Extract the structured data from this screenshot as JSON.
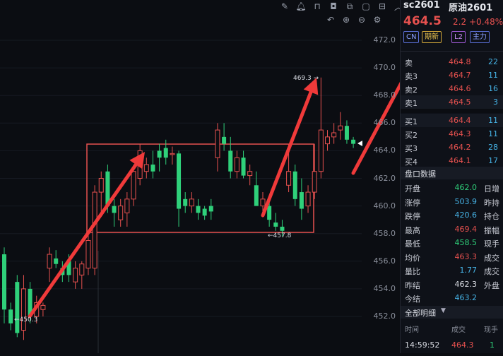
{
  "chart": {
    "y_ticks": [
      "472.0",
      "470.0",
      "468.0",
      "466.0",
      "464.0",
      "462.0",
      "460.0",
      "458.0",
      "456.0",
      "454.0",
      "452.0"
    ],
    "high_label": "469.3",
    "mid_low_label": "457.8",
    "low_label": "450.3"
  },
  "panel": {
    "symbol": "sc2601",
    "name": "原油2601",
    "price": "464.5",
    "change": "2.2",
    "change_pct": "+0.48%",
    "badges": [
      "CN",
      "期新",
      "L2",
      "主力"
    ],
    "asks": [
      {
        "label": "卖",
        "price": "464.8",
        "vol": "22"
      },
      {
        "label": "卖3",
        "price": "464.7",
        "vol": "11"
      },
      {
        "label": "卖2",
        "price": "464.6",
        "vol": "16"
      },
      {
        "label": "卖1",
        "price": "464.5",
        "vol": "3"
      }
    ],
    "bids": [
      {
        "label": "买1",
        "price": "464.4",
        "vol": "11"
      },
      {
        "label": "买2",
        "price": "464.3",
        "vol": "11"
      },
      {
        "label": "买3",
        "price": "464.2",
        "vol": "28"
      },
      {
        "label": "买4",
        "price": "464.1",
        "vol": "17"
      }
    ],
    "section_title": "盘口数据",
    "stats": [
      {
        "k": "开盘",
        "v": "462.0",
        "c": "#2fd07a",
        "k2": "日增"
      },
      {
        "k": "涨停",
        "v": "503.9",
        "c": "#46b3e6",
        "k2": "昨持"
      },
      {
        "k": "跌停",
        "v": "420.6",
        "c": "#46b3e6",
        "k2": "持仓"
      },
      {
        "k": "最高",
        "v": "469.4",
        "c": "#e7514f",
        "k2": "振幅"
      },
      {
        "k": "最低",
        "v": "458.5",
        "c": "#2fd07a",
        "k2": "现手"
      },
      {
        "k": "均价",
        "v": "463.3",
        "c": "#e7514f",
        "k2": "成交"
      },
      {
        "k": "量比",
        "v": "1.77",
        "c": "#46b3e6",
        "k2": "成交"
      },
      {
        "k": "昨结",
        "v": "462.3",
        "c": "#d8dbe2",
        "k2": "外盘"
      },
      {
        "k": "今结",
        "v": "463.2",
        "c": "#46b3e6",
        "k2": ""
      }
    ],
    "detail_title": "全部明细",
    "detail_cols": [
      "时间",
      "成交",
      "现手"
    ],
    "detail_row": {
      "time": "14:59:52",
      "price": "464.3",
      "vol": "1"
    }
  },
  "colors": {
    "up": "#e7514f",
    "down": "#2fd07a",
    "bg": "#0b0d12"
  },
  "candles": [
    {
      "o": 456.5,
      "h": 457.0,
      "l": 451.5,
      "c": 452.5
    },
    {
      "o": 452.5,
      "h": 453.0,
      "l": 451.0,
      "c": 451.5
    },
    {
      "o": 454.5,
      "h": 455.0,
      "l": 450.5,
      "c": 450.8
    },
    {
      "o": 451.0,
      "h": 455.0,
      "l": 450.3,
      "c": 454.0
    },
    {
      "o": 454.0,
      "h": 454.5,
      "l": 451.5,
      "c": 452.0
    },
    {
      "o": 452.0,
      "h": 453.5,
      "l": 451.5,
      "c": 453.0
    },
    {
      "o": 452.5,
      "h": 453.0,
      "l": 452.0,
      "c": 452.8
    },
    {
      "o": 455.5,
      "h": 457.0,
      "l": 454.5,
      "c": 456.5
    },
    {
      "o": 456.2,
      "h": 456.8,
      "l": 455.5,
      "c": 455.8
    },
    {
      "o": 455.5,
      "h": 456.0,
      "l": 454.5,
      "c": 455.0
    },
    {
      "o": 456.0,
      "h": 456.5,
      "l": 454.5,
      "c": 455.0
    },
    {
      "o": 454.5,
      "h": 456.0,
      "l": 454.0,
      "c": 455.5
    },
    {
      "o": 455.0,
      "h": 456.0,
      "l": 454.0,
      "c": 455.8
    },
    {
      "o": 455.5,
      "h": 458.0,
      "l": 455.0,
      "c": 457.5
    },
    {
      "o": 455.5,
      "h": 461.5,
      "l": 455.0,
      "c": 461.0
    },
    {
      "o": 461.0,
      "h": 462.5,
      "l": 459.5,
      "c": 462.0
    },
    {
      "o": 462.5,
      "h": 463.0,
      "l": 459.5,
      "c": 460.0
    },
    {
      "o": 460.0,
      "h": 460.5,
      "l": 458.5,
      "c": 459.5
    },
    {
      "o": 459.0,
      "h": 460.5,
      "l": 458.5,
      "c": 460.0
    },
    {
      "o": 459.5,
      "h": 461.0,
      "l": 458.5,
      "c": 460.5
    },
    {
      "o": 460.5,
      "h": 463.0,
      "l": 460.0,
      "c": 462.5
    },
    {
      "o": 462.0,
      "h": 464.5,
      "l": 461.5,
      "c": 464.0
    },
    {
      "o": 462.5,
      "h": 463.5,
      "l": 462.0,
      "c": 463.0
    },
    {
      "o": 463.0,
      "h": 464.0,
      "l": 462.0,
      "c": 462.5
    },
    {
      "o": 464.0,
      "h": 464.5,
      "l": 462.5,
      "c": 463.5
    },
    {
      "o": 464.2,
      "h": 464.8,
      "l": 463.0,
      "c": 463.5
    },
    {
      "o": 463.8,
      "h": 464.3,
      "l": 463.0,
      "c": 463.8
    },
    {
      "o": 463.8,
      "h": 464.0,
      "l": 458.5,
      "c": 459.8
    },
    {
      "o": 460.5,
      "h": 461.0,
      "l": 459.5,
      "c": 460.0
    },
    {
      "o": 460.0,
      "h": 461.0,
      "l": 459.5,
      "c": 460.5
    },
    {
      "o": 460.0,
      "h": 460.5,
      "l": 459.0,
      "c": 459.5
    },
    {
      "o": 459.8,
      "h": 460.0,
      "l": 459.0,
      "c": 459.3
    },
    {
      "o": 460.0,
      "h": 460.5,
      "l": 459.0,
      "c": 459.6
    },
    {
      "o": 463.5,
      "h": 466.0,
      "l": 462.5,
      "c": 465.5
    },
    {
      "o": 465.0,
      "h": 466.0,
      "l": 464.0,
      "c": 464.5
    },
    {
      "o": 464.0,
      "h": 465.0,
      "l": 462.0,
      "c": 462.5
    },
    {
      "o": 462.5,
      "h": 464.0,
      "l": 462.0,
      "c": 463.5
    },
    {
      "o": 463.5,
      "h": 464.0,
      "l": 462.0,
      "c": 462.2
    },
    {
      "o": 462.2,
      "h": 463.0,
      "l": 461.5,
      "c": 462.5
    },
    {
      "o": 461.5,
      "h": 462.5,
      "l": 461.0,
      "c": 460.0
    },
    {
      "o": 460.0,
      "h": 461.0,
      "l": 459.5,
      "c": 460.5
    },
    {
      "o": 460.0,
      "h": 460.5,
      "l": 458.5,
      "c": 459.0
    },
    {
      "o": 458.8,
      "h": 459.5,
      "l": 458.2,
      "c": 458.5
    },
    {
      "o": 458.5,
      "h": 459.0,
      "l": 457.8,
      "c": 458.2
    },
    {
      "o": 461.5,
      "h": 464.5,
      "l": 461.0,
      "c": 462.5
    },
    {
      "o": 462.5,
      "h": 463.0,
      "l": 460.0,
      "c": 460.5
    },
    {
      "o": 461.0,
      "h": 462.0,
      "l": 459.0,
      "c": 459.8
    },
    {
      "o": 460.0,
      "h": 461.5,
      "l": 459.5,
      "c": 461.0
    },
    {
      "o": 461.0,
      "h": 464.5,
      "l": 460.5,
      "c": 462.5
    },
    {
      "o": 462.5,
      "h": 469.3,
      "l": 462.0,
      "c": 465.5
    },
    {
      "o": 464.5,
      "h": 465.5,
      "l": 464.0,
      "c": 465.0
    },
    {
      "o": 465.0,
      "h": 466.0,
      "l": 464.5,
      "c": 465.3
    },
    {
      "o": 465.5,
      "h": 466.8,
      "l": 464.8,
      "c": 465.8
    },
    {
      "o": 465.8,
      "h": 466.2,
      "l": 464.5,
      "c": 464.8
    },
    {
      "o": 464.8,
      "h": 465.0,
      "l": 464.2,
      "c": 464.5
    }
  ]
}
